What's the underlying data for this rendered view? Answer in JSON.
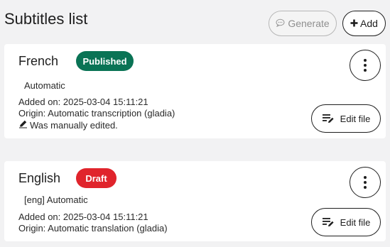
{
  "header": {
    "title": "Subtitles list",
    "generate_label": "Generate",
    "add_label": "Add"
  },
  "subtitles": [
    {
      "language": "French",
      "status": "Published",
      "status_color": "#0a7355",
      "tag": "Automatic",
      "added_on": "Added on: 2025-03-04 15:11:21",
      "origin": "Origin: Automatic transcription (gladia)",
      "edited_note": "Was manually edited.",
      "edit_label": "Edit file"
    },
    {
      "language": "English",
      "status": "Draft",
      "status_color": "#e0242c",
      "tag": "[eng] Automatic",
      "added_on": "Added on: 2025-03-04 15:11:21",
      "origin": "Origin: Automatic translation (gladia)",
      "edit_label": "Edit file"
    }
  ],
  "icons": {
    "generate": "speech-bubble-icon",
    "add": "plus-icon",
    "menu": "kebab-menu-icon",
    "edit": "edit-file-icon",
    "edited": "pencil-icon"
  }
}
